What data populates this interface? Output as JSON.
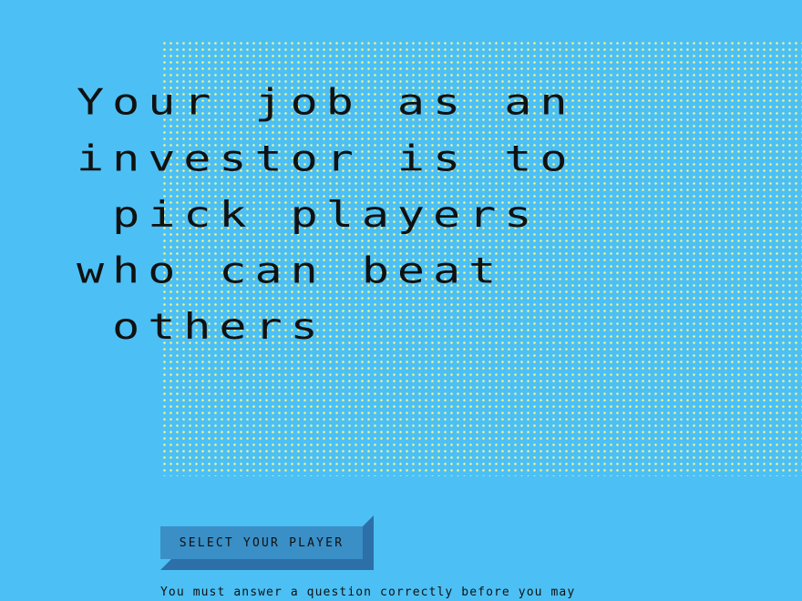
{
  "headline": {
    "lines": [
      "Your job as an",
      "investor is to",
      " pick players",
      "who can beat",
      " others"
    ]
  },
  "button": {
    "label": "SELECT YOUR PLAYER"
  },
  "hint": {
    "text": "You must answer a question correctly before you may"
  },
  "colors": {
    "background": "#4cc0f4",
    "dots": "#f4f08a",
    "text": "#111111",
    "button": "#3a8fc7",
    "button_shadow": "#2d6fa8"
  }
}
